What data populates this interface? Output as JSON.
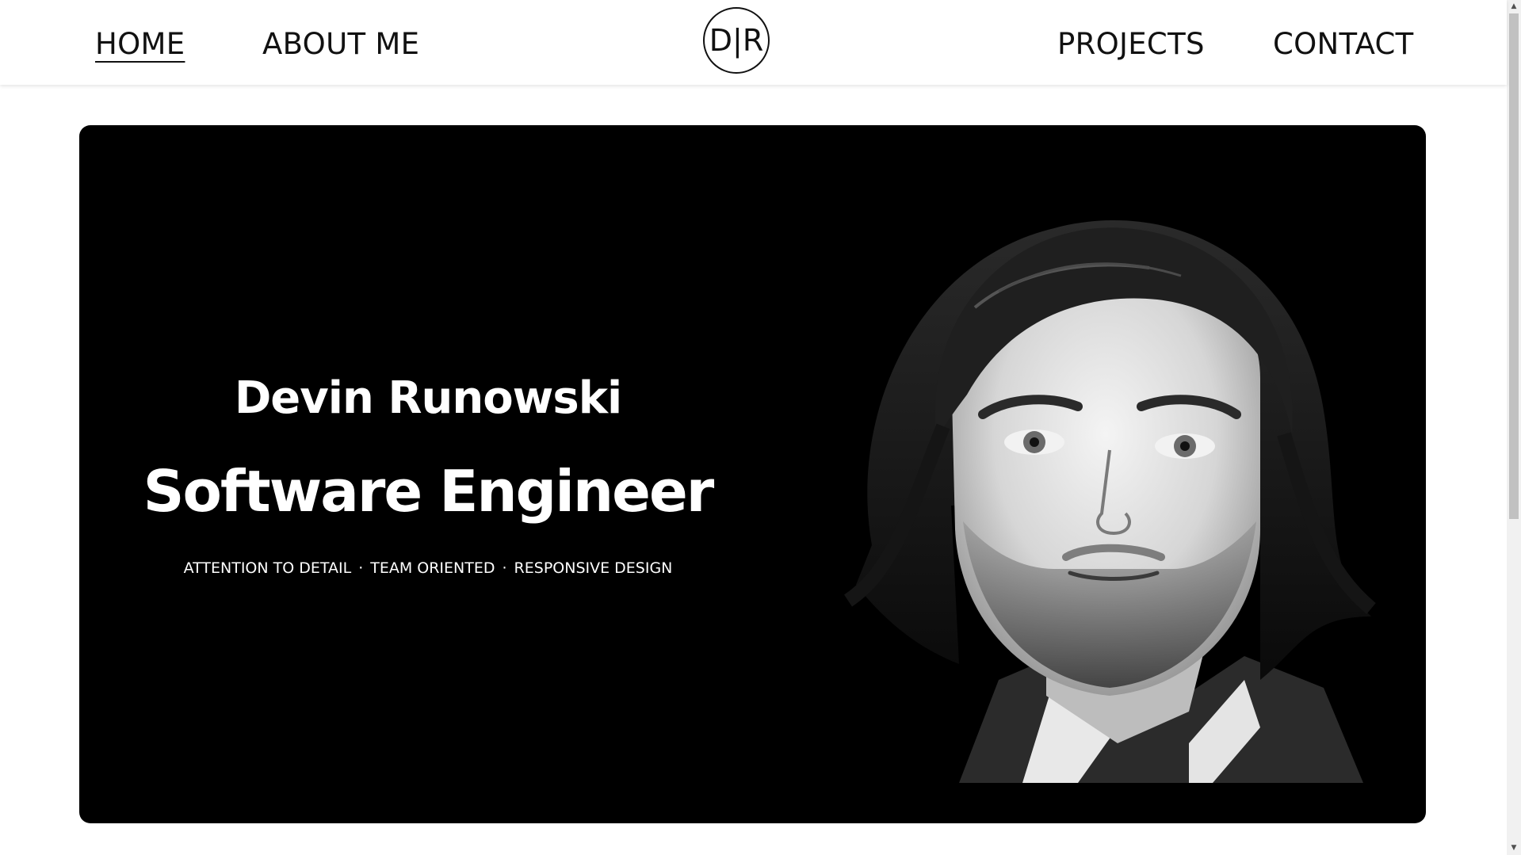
{
  "header": {
    "nav_left": [
      {
        "label": "HOME",
        "active": true
      },
      {
        "label": "ABOUT ME",
        "active": false
      }
    ],
    "logo_text": "D|R",
    "nav_right": [
      {
        "label": "PROJECTS",
        "active": false
      },
      {
        "label": "CONTACT",
        "active": false
      }
    ]
  },
  "hero": {
    "name": "Devin Runowski",
    "role": "Software Engineer",
    "tags": [
      "ATTENTION TO DETAIL",
      "TEAM ORIENTED",
      "RESPONSIVE DESIGN"
    ],
    "tag_separator": "·",
    "portrait_icon": "portrait-illustration",
    "background_color": "#000000",
    "text_color": "#ffffff"
  },
  "scrollbar": {
    "up_icon": "scroll-up-arrow-icon",
    "down_icon": "scroll-down-arrow-icon"
  }
}
